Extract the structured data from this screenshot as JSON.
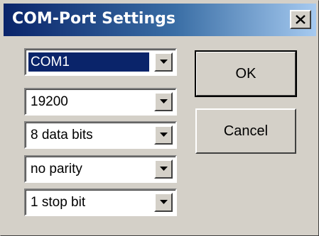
{
  "window": {
    "title": "COM-Port Settings",
    "close_icon": "close-icon"
  },
  "settings": {
    "port": "COM1",
    "baud_rate": "19200",
    "data_bits": "8 data bits",
    "parity": "no parity",
    "stop_bits": "1 stop bit"
  },
  "buttons": {
    "ok_label": "OK",
    "cancel_label": "Cancel"
  },
  "colors": {
    "titlebar_start": "#0a246a",
    "titlebar_end": "#a6caf0",
    "face": "#d4d0c8",
    "selection": "#0a246a"
  }
}
